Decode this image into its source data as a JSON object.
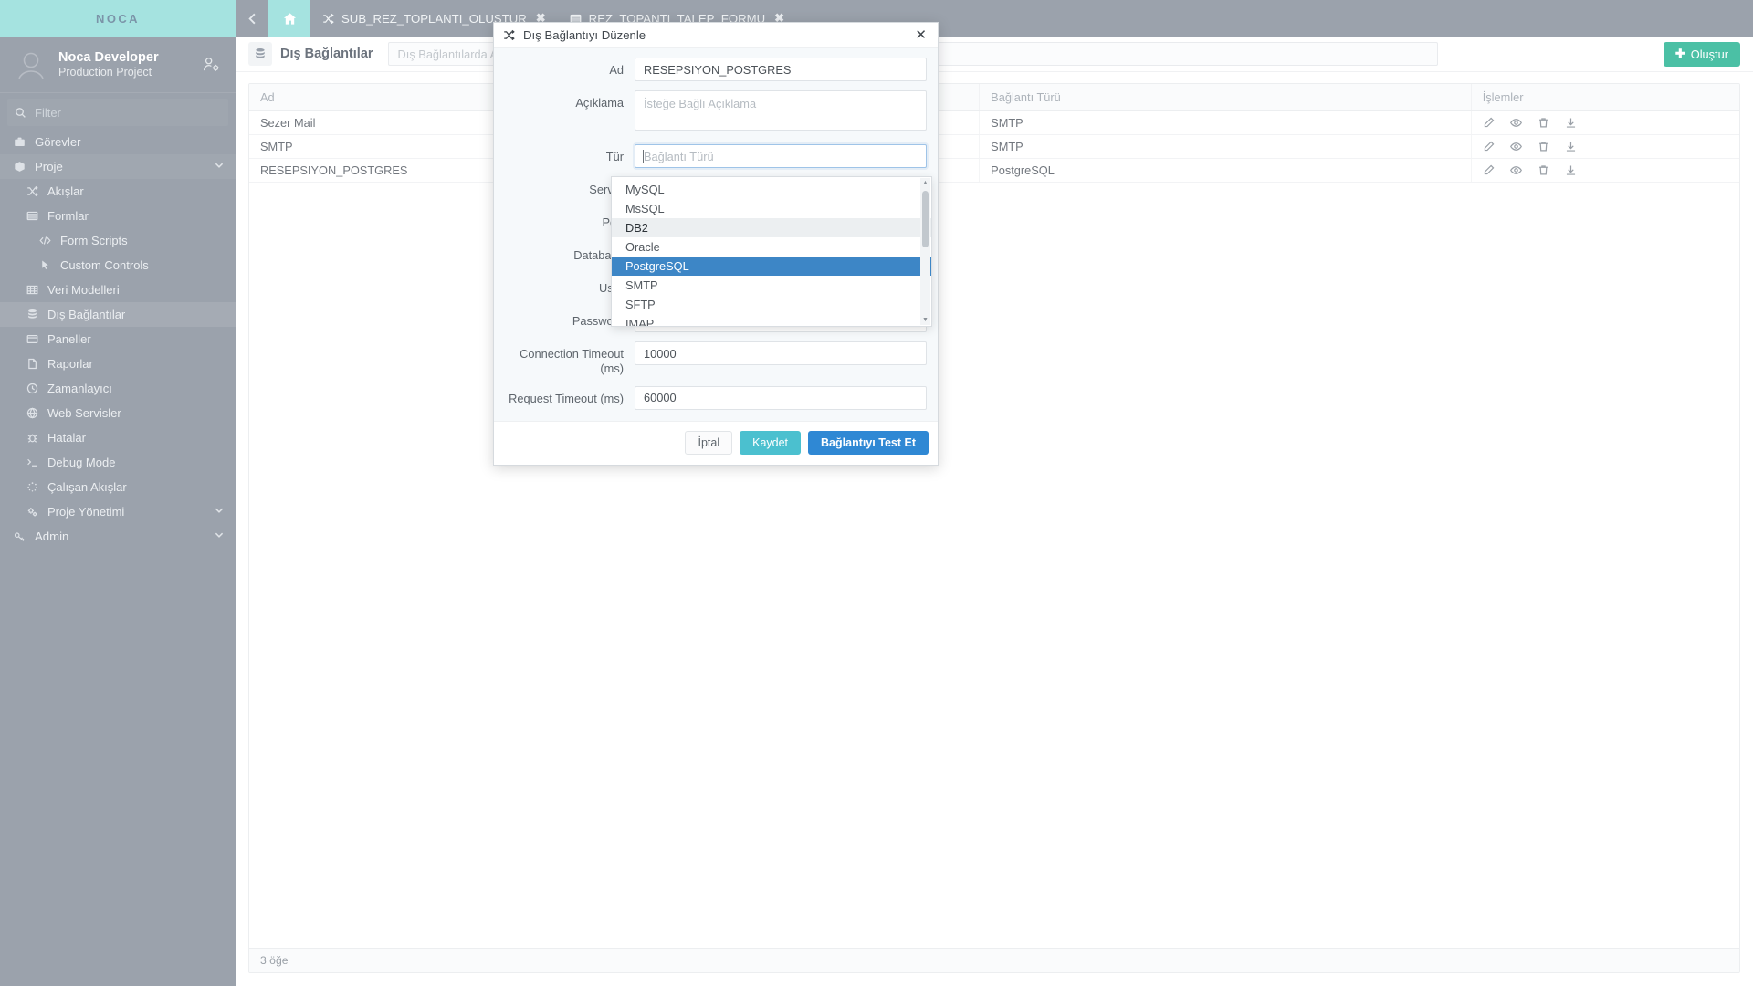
{
  "brand": {
    "logo": "NOCA"
  },
  "user": {
    "name": "Noca Developer",
    "project": "Production Project"
  },
  "sidebar": {
    "filter_placeholder": "Filter",
    "items": [
      {
        "label": "Görevler",
        "icon": "briefcase-icon",
        "level": 1,
        "active": false,
        "group": false
      },
      {
        "label": "Proje",
        "icon": "box-icon",
        "level": 1,
        "active": false,
        "group": true,
        "chevron": true
      },
      {
        "label": "Akışlar",
        "icon": "shuffle-icon",
        "level": 2,
        "active": false,
        "group": false
      },
      {
        "label": "Formlar",
        "icon": "form-icon",
        "level": 2,
        "active": false,
        "group": false
      },
      {
        "label": "Form Scripts",
        "icon": "code-icon",
        "level": 3,
        "active": false,
        "group": false
      },
      {
        "label": "Custom Controls",
        "icon": "cursor-icon",
        "level": 3,
        "active": false,
        "group": false
      },
      {
        "label": "Veri Modelleri",
        "icon": "grid-icon",
        "level": 2,
        "active": false,
        "group": false
      },
      {
        "label": "Dış Bağlantılar",
        "icon": "database-icon",
        "level": 2,
        "active": true,
        "group": false
      },
      {
        "label": "Paneller",
        "icon": "panel-icon",
        "level": 2,
        "active": false,
        "group": false
      },
      {
        "label": "Raporlar",
        "icon": "report-icon",
        "level": 2,
        "active": false,
        "group": false
      },
      {
        "label": "Zamanlayıcı",
        "icon": "clock-icon",
        "level": 2,
        "active": false,
        "group": false
      },
      {
        "label": "Web Servisler",
        "icon": "globe-icon",
        "level": 2,
        "active": false,
        "group": false
      },
      {
        "label": "Hatalar",
        "icon": "bug-icon",
        "level": 2,
        "active": false,
        "group": false
      },
      {
        "label": "Debug Mode",
        "icon": "terminal-icon",
        "level": 2,
        "active": false,
        "group": false
      },
      {
        "label": "Çalışan Akışlar",
        "icon": "spinner-icon",
        "level": 2,
        "active": false,
        "group": false
      },
      {
        "label": "Proje Yönetimi",
        "icon": "gears-icon",
        "level": 2,
        "active": false,
        "group": false,
        "chevron": true
      },
      {
        "label": "Admin",
        "icon": "key-icon",
        "level": 1,
        "active": false,
        "group": false,
        "chevron": true
      }
    ]
  },
  "tabs": [
    {
      "label": "SUB_REZ_TOPLANTI_OLUSTUR",
      "icon": "shuffle-icon",
      "closable": true
    },
    {
      "label": "REZ_TOPANTI_TALEP_FORMU",
      "icon": "form-icon",
      "closable": true
    }
  ],
  "page": {
    "title": "Dış Bağlantılar",
    "icon": "database-icon",
    "search_placeholder": "Dış Bağlantılarda Ara",
    "create_label": "Oluştur",
    "footer_count": "3 öğe"
  },
  "table": {
    "columns": [
      "Ad",
      "Bağlantı Türü",
      "İşlemler"
    ],
    "rows": [
      {
        "name": "Sezer Mail",
        "type": "SMTP"
      },
      {
        "name": "SMTP",
        "type": "SMTP"
      },
      {
        "name": "RESEPSIYON_POSTGRES",
        "type": "PostgreSQL"
      }
    ],
    "row_action_icons": [
      "edit-icon",
      "view-icon",
      "delete-icon",
      "download-icon"
    ]
  },
  "modal": {
    "title": "Dış Bağlantıyı Düzenle",
    "icon": "shuffle-icon",
    "close_label": "✕",
    "fields": {
      "ad_label": "Ad",
      "ad_value": "RESEPSIYON_POSTGRES",
      "aciklama_label": "Açıklama",
      "aciklama_placeholder": "İsteğe Bağlı Açıklama",
      "tur_label": "Tür",
      "tur_placeholder": "Bağlantı Türü",
      "server_label": "Server",
      "port_label": "Port",
      "database_label": "Database",
      "user_label": "User",
      "password_label": "Password",
      "conn_timeout_label": "Connection Timeout (ms)",
      "conn_timeout_value": "10000",
      "req_timeout_label": "Request Timeout (ms)",
      "req_timeout_value": "60000"
    },
    "dropdown": {
      "options": [
        {
          "label": "MySQL",
          "state": "normal"
        },
        {
          "label": "MsSQL",
          "state": "normal"
        },
        {
          "label": "DB2",
          "state": "hover"
        },
        {
          "label": "Oracle",
          "state": "normal"
        },
        {
          "label": "PostgreSQL",
          "state": "selected"
        },
        {
          "label": "SMTP",
          "state": "normal"
        },
        {
          "label": "SFTP",
          "state": "normal"
        },
        {
          "label": "IMAP",
          "state": "normal"
        }
      ]
    },
    "buttons": {
      "cancel": "İptal",
      "save": "Kaydet",
      "test": "Bağlantıyı Test Et"
    }
  },
  "colors": {
    "brand_teal": "#a5e3e0",
    "sidebar_gray": "#9ba2ac",
    "accent_green": "#4bc0a5",
    "accent_cyan": "#4bc0cf",
    "accent_blue": "#2f88d4",
    "selection_blue": "#3d86c6"
  }
}
